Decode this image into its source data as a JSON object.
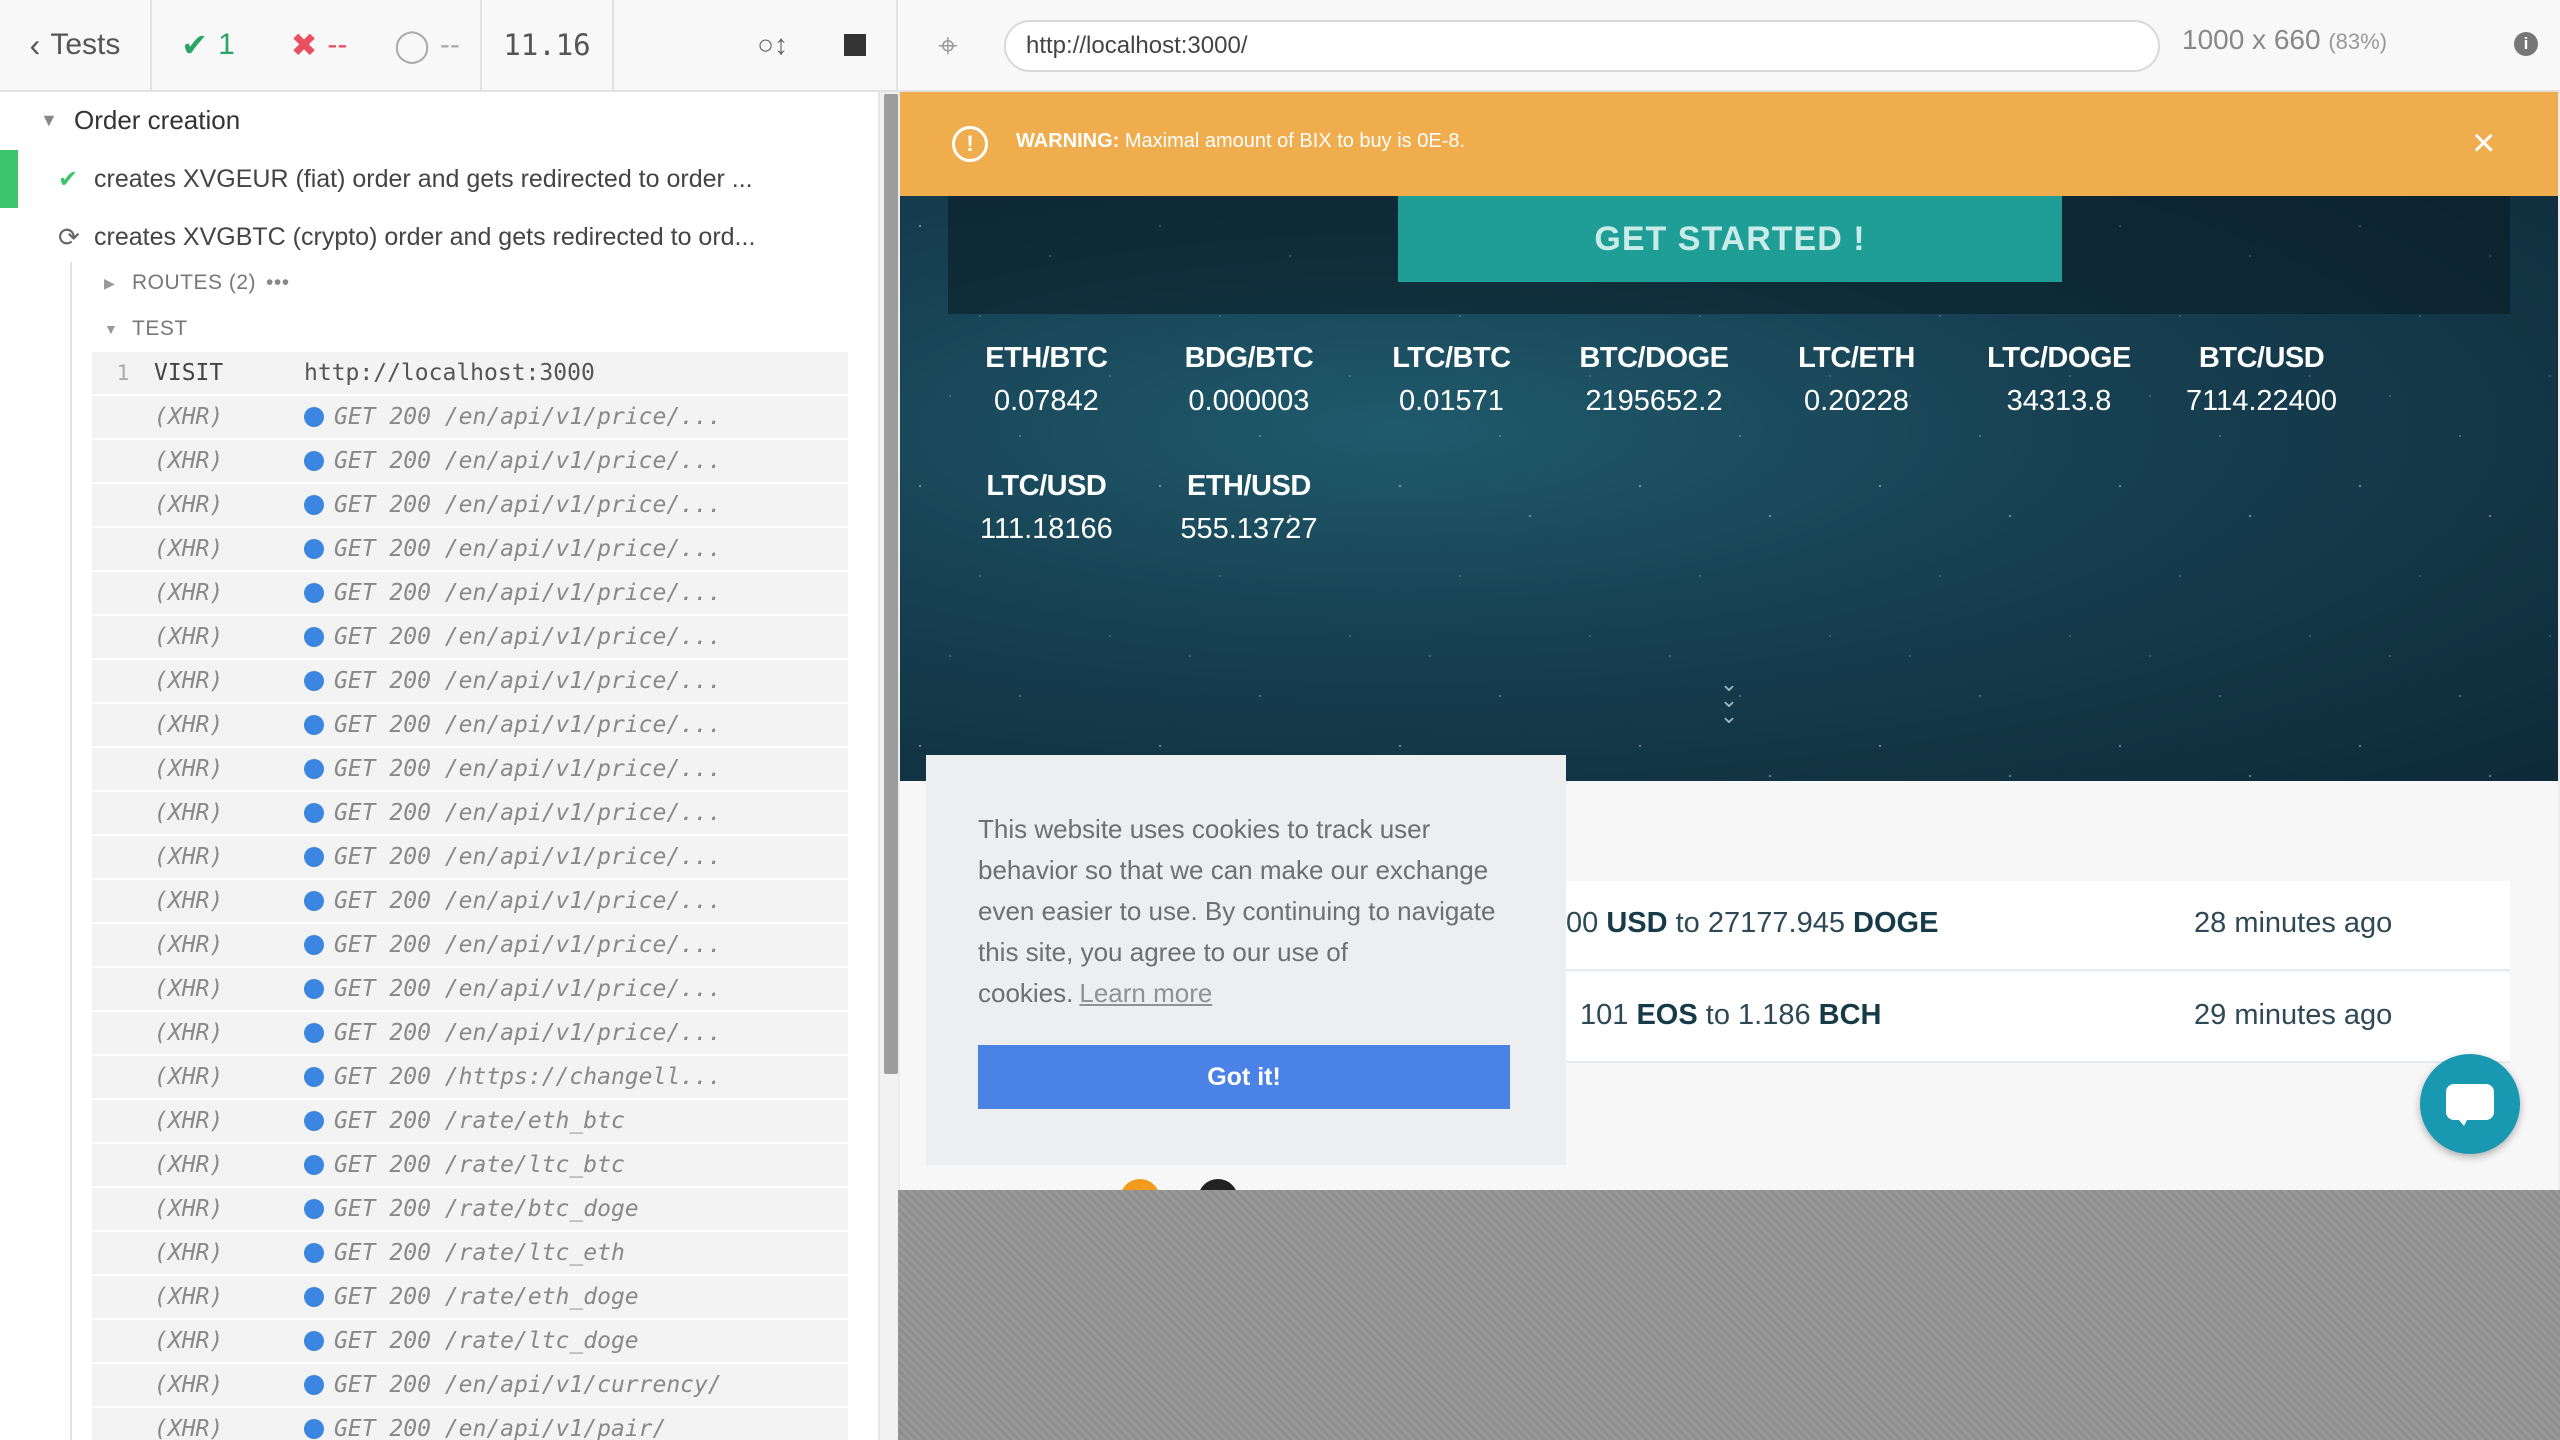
{
  "header": {
    "tests_label": "Tests",
    "passed": "1",
    "failed": "--",
    "pending": "--",
    "duration": "11.16"
  },
  "suite": {
    "title": "Order creation",
    "tests": [
      {
        "title": "creates XVGEUR (fiat) order and gets redirected to order ...",
        "state": "passed"
      },
      {
        "title": "creates XVGBTC (crypto) order and gets redirected to ord...",
        "state": "running"
      }
    ],
    "routes_label": "ROUTES (2)",
    "test_label": "TEST"
  },
  "commands": [
    {
      "num": "1",
      "name": "VISIT",
      "message": "http://localhost:3000",
      "xhr": false
    },
    {
      "num": "",
      "name": "(XHR)",
      "message": "GET 200 /en/api/v1/price/...",
      "xhr": true
    },
    {
      "num": "",
      "name": "(XHR)",
      "message": "GET 200 /en/api/v1/price/...",
      "xhr": true
    },
    {
      "num": "",
      "name": "(XHR)",
      "message": "GET 200 /en/api/v1/price/...",
      "xhr": true
    },
    {
      "num": "",
      "name": "(XHR)",
      "message": "GET 200 /en/api/v1/price/...",
      "xhr": true
    },
    {
      "num": "",
      "name": "(XHR)",
      "message": "GET 200 /en/api/v1/price/...",
      "xhr": true
    },
    {
      "num": "",
      "name": "(XHR)",
      "message": "GET 200 /en/api/v1/price/...",
      "xhr": true
    },
    {
      "num": "",
      "name": "(XHR)",
      "message": "GET 200 /en/api/v1/price/...",
      "xhr": true
    },
    {
      "num": "",
      "name": "(XHR)",
      "message": "GET 200 /en/api/v1/price/...",
      "xhr": true
    },
    {
      "num": "",
      "name": "(XHR)",
      "message": "GET 200 /en/api/v1/price/...",
      "xhr": true
    },
    {
      "num": "",
      "name": "(XHR)",
      "message": "GET 200 /en/api/v1/price/...",
      "xhr": true
    },
    {
      "num": "",
      "name": "(XHR)",
      "message": "GET 200 /en/api/v1/price/...",
      "xhr": true
    },
    {
      "num": "",
      "name": "(XHR)",
      "message": "GET 200 /en/api/v1/price/...",
      "xhr": true
    },
    {
      "num": "",
      "name": "(XHR)",
      "message": "GET 200 /en/api/v1/price/...",
      "xhr": true
    },
    {
      "num": "",
      "name": "(XHR)",
      "message": "GET 200 /en/api/v1/price/...",
      "xhr": true
    },
    {
      "num": "",
      "name": "(XHR)",
      "message": "GET 200 /en/api/v1/price/...",
      "xhr": true
    },
    {
      "num": "",
      "name": "(XHR)",
      "message": "GET 200 /https://changell...",
      "xhr": true
    },
    {
      "num": "",
      "name": "(XHR)",
      "message": "GET 200 /rate/eth_btc",
      "xhr": true
    },
    {
      "num": "",
      "name": "(XHR)",
      "message": "GET 200 /rate/ltc_btc",
      "xhr": true
    },
    {
      "num": "",
      "name": "(XHR)",
      "message": "GET 200 /rate/btc_doge",
      "xhr": true
    },
    {
      "num": "",
      "name": "(XHR)",
      "message": "GET 200 /rate/ltc_eth",
      "xhr": true
    },
    {
      "num": "",
      "name": "(XHR)",
      "message": "GET 200 /rate/eth_doge",
      "xhr": true
    },
    {
      "num": "",
      "name": "(XHR)",
      "message": "GET 200 /rate/ltc_doge",
      "xhr": true
    },
    {
      "num": "",
      "name": "(XHR)",
      "message": "GET 200 /en/api/v1/currency/",
      "xhr": true
    },
    {
      "num": "",
      "name": "(XHR)",
      "message": "GET 200 /en/api/v1/pair/",
      "xhr": true
    }
  ],
  "browser": {
    "url": "http://localhost:3000/",
    "viewport": "1000 x 660",
    "scale": "(83%)"
  },
  "app": {
    "warning_label": "WARNING:",
    "warning_text": "Maximal amount of BIX to buy is 0E-8.",
    "get_started": "GET STARTED !",
    "rates": [
      {
        "pair": "ETH/BTC",
        "value": "0.07842"
      },
      {
        "pair": "BDG/BTC",
        "value": "0.000003"
      },
      {
        "pair": "LTC/BTC",
        "value": "0.01571"
      },
      {
        "pair": "BTC/DOGE",
        "value": "2195652.2"
      },
      {
        "pair": "LTC/ETH",
        "value": "0.20228"
      },
      {
        "pair": "LTC/DOGE",
        "value": "34313.8"
      },
      {
        "pair": "BTC/USD",
        "value": "7114.22400"
      },
      {
        "pair": "LTC/USD",
        "value": "111.18166"
      },
      {
        "pair": "ETH/USD",
        "value": "555.13727"
      }
    ],
    "trades": [
      {
        "prefix": "00",
        "from": "USD",
        "to_word": "to",
        "amount": "27177.945",
        "to": "DOGE",
        "time": "28 minutes ago"
      },
      {
        "prefix": "101",
        "from": "EOS",
        "to_word": "to",
        "amount": "1.186",
        "to": "BCH",
        "time": "29 minutes ago"
      }
    ],
    "cookie": {
      "text": "This website uses cookies to track user behavior so that we can make our exchange even easier to use. By continuing to navigate this site, you agree to our use of cookies.",
      "learn_more": "Learn more",
      "button": "Got it!"
    }
  },
  "colors": {
    "pass": "#3cc56c",
    "fail": "#e94f5e",
    "warning": "#f0ad4e",
    "xhr_dot": "#3b86e0",
    "get_started": "#1f9e95",
    "cookie_button": "#4b82e5",
    "chat": "#1998b1"
  }
}
